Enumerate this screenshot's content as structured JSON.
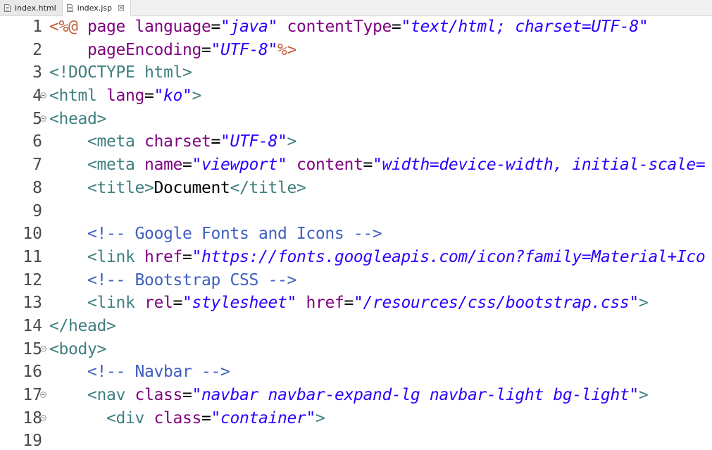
{
  "tabs": [
    {
      "label": "index.html",
      "active": false
    },
    {
      "label": "index.jsp",
      "active": true,
      "close": "☒"
    }
  ],
  "lines": [
    {
      "n": "1",
      "fold": false,
      "tokens": [
        {
          "c": "t-dir",
          "t": "<%@ "
        },
        {
          "c": "t-attr",
          "t": "page "
        },
        {
          "c": "t-attr",
          "t": "language"
        },
        {
          "c": "t-pun",
          "t": "="
        },
        {
          "c": "t-str",
          "t": "\"java\""
        },
        {
          "c": "t-pun",
          "t": " "
        },
        {
          "c": "t-attr",
          "t": "contentType"
        },
        {
          "c": "t-pun",
          "t": "="
        },
        {
          "c": "t-str",
          "t": "\"text/html; charset=UTF-8\""
        }
      ]
    },
    {
      "n": "2",
      "fold": false,
      "tokens": [
        {
          "c": "t-pun",
          "t": "    "
        },
        {
          "c": "t-attr",
          "t": "pageEncoding"
        },
        {
          "c": "t-pun",
          "t": "="
        },
        {
          "c": "t-str",
          "t": "\"UTF-8\""
        },
        {
          "c": "t-dir",
          "t": "%>"
        }
      ]
    },
    {
      "n": "3",
      "fold": false,
      "tokens": [
        {
          "c": "t-tag",
          "t": "<!DOCTYPE "
        },
        {
          "c": "t-tag",
          "t": "html"
        },
        {
          "c": "t-tag",
          "t": ">"
        }
      ]
    },
    {
      "n": "4",
      "fold": true,
      "tokens": [
        {
          "c": "t-tag",
          "t": "<html "
        },
        {
          "c": "t-attr",
          "t": "lang"
        },
        {
          "c": "t-pun",
          "t": "="
        },
        {
          "c": "t-str",
          "t": "\"ko\""
        },
        {
          "c": "t-tag",
          "t": ">"
        }
      ]
    },
    {
      "n": "5",
      "fold": true,
      "tokens": [
        {
          "c": "t-tag",
          "t": "<head>"
        }
      ]
    },
    {
      "n": "6",
      "fold": false,
      "tokens": [
        {
          "c": "t-pun",
          "t": "    "
        },
        {
          "c": "t-tag",
          "t": "<meta "
        },
        {
          "c": "t-attr",
          "t": "charset"
        },
        {
          "c": "t-pun",
          "t": "="
        },
        {
          "c": "t-str",
          "t": "\"UTF-8\""
        },
        {
          "c": "t-tag",
          "t": ">"
        }
      ]
    },
    {
      "n": "7",
      "fold": false,
      "tokens": [
        {
          "c": "t-pun",
          "t": "    "
        },
        {
          "c": "t-tag",
          "t": "<meta "
        },
        {
          "c": "t-attr",
          "t": "name"
        },
        {
          "c": "t-pun",
          "t": "="
        },
        {
          "c": "t-str",
          "t": "\"viewport\""
        },
        {
          "c": "t-pun",
          "t": " "
        },
        {
          "c": "t-attr",
          "t": "content"
        },
        {
          "c": "t-pun",
          "t": "="
        },
        {
          "c": "t-str",
          "t": "\"width=device-width, initial-scale="
        }
      ]
    },
    {
      "n": "8",
      "fold": false,
      "tokens": [
        {
          "c": "t-pun",
          "t": "    "
        },
        {
          "c": "t-tag",
          "t": "<title>"
        },
        {
          "c": "t-plain",
          "t": "Document"
        },
        {
          "c": "t-tag",
          "t": "</title>"
        }
      ]
    },
    {
      "n": "9",
      "fold": false,
      "tokens": []
    },
    {
      "n": "10",
      "fold": false,
      "tokens": [
        {
          "c": "t-pun",
          "t": "    "
        },
        {
          "c": "t-comm",
          "t": "<!-- Google Fonts and Icons -->"
        }
      ]
    },
    {
      "n": "11",
      "fold": false,
      "tokens": [
        {
          "c": "t-pun",
          "t": "    "
        },
        {
          "c": "t-tag",
          "t": "<link "
        },
        {
          "c": "t-attr",
          "t": "href"
        },
        {
          "c": "t-pun",
          "t": "="
        },
        {
          "c": "t-str",
          "t": "\"https://fonts.googleapis.com/icon?family=Material+Ico"
        }
      ]
    },
    {
      "n": "12",
      "fold": false,
      "tokens": [
        {
          "c": "t-pun",
          "t": "    "
        },
        {
          "c": "t-comm",
          "t": "<!-- Bootstrap CSS -->"
        }
      ]
    },
    {
      "n": "13",
      "fold": false,
      "tokens": [
        {
          "c": "t-pun",
          "t": "    "
        },
        {
          "c": "t-tag",
          "t": "<link "
        },
        {
          "c": "t-attr",
          "t": "rel"
        },
        {
          "c": "t-pun",
          "t": "="
        },
        {
          "c": "t-str",
          "t": "\"stylesheet\""
        },
        {
          "c": "t-pun",
          "t": " "
        },
        {
          "c": "t-attr",
          "t": "href"
        },
        {
          "c": "t-pun",
          "t": "="
        },
        {
          "c": "t-str",
          "t": "\"/resources/css/bootstrap.css\""
        },
        {
          "c": "t-tag",
          "t": ">"
        }
      ]
    },
    {
      "n": "14",
      "fold": false,
      "tokens": [
        {
          "c": "t-tag",
          "t": "</head>"
        }
      ]
    },
    {
      "n": "15",
      "fold": true,
      "tokens": [
        {
          "c": "t-tag",
          "t": "<body>"
        }
      ]
    },
    {
      "n": "16",
      "fold": false,
      "tokens": [
        {
          "c": "t-pun",
          "t": "    "
        },
        {
          "c": "t-comm",
          "t": "<!-- Navbar -->"
        }
      ]
    },
    {
      "n": "17",
      "fold": true,
      "tokens": [
        {
          "c": "t-pun",
          "t": "    "
        },
        {
          "c": "t-tag",
          "t": "<nav "
        },
        {
          "c": "t-attr",
          "t": "class"
        },
        {
          "c": "t-pun",
          "t": "="
        },
        {
          "c": "t-str",
          "t": "\"navbar navbar-expand-lg navbar-light bg-light\""
        },
        {
          "c": "t-tag",
          "t": ">"
        }
      ]
    },
    {
      "n": "18",
      "fold": true,
      "tokens": [
        {
          "c": "t-pun",
          "t": "      "
        },
        {
          "c": "t-tag",
          "t": "<div "
        },
        {
          "c": "t-attr",
          "t": "class"
        },
        {
          "c": "t-pun",
          "t": "="
        },
        {
          "c": "t-str",
          "t": "\"container\""
        },
        {
          "c": "t-tag",
          "t": ">"
        }
      ]
    },
    {
      "n": "19",
      "fold": false,
      "tokens": []
    }
  ]
}
